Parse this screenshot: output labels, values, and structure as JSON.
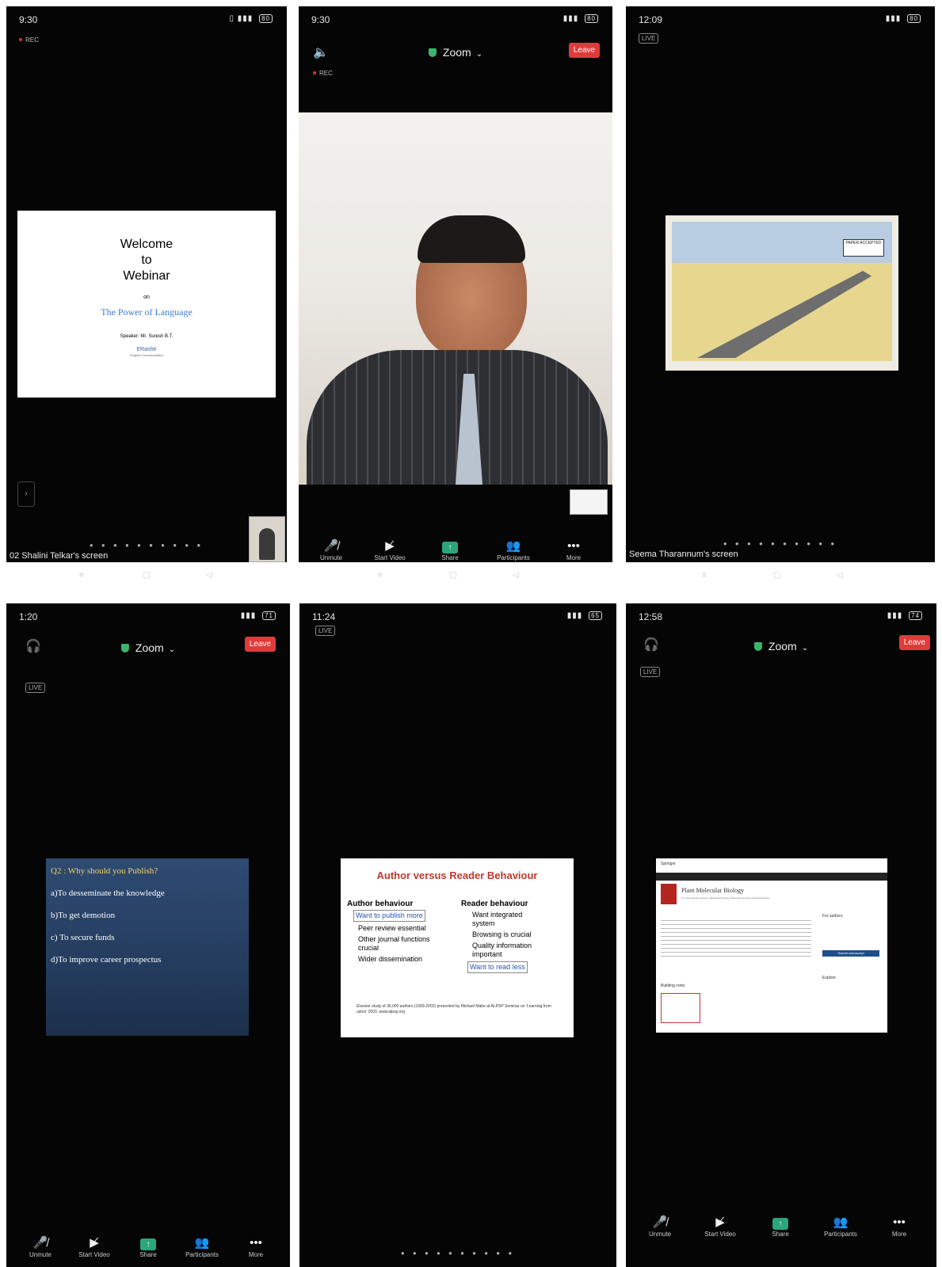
{
  "screens": {
    "s1": {
      "time": "9:30",
      "notif": "3",
      "battery": "80",
      "rec": "REC",
      "slide": {
        "line1": "Welcome",
        "line2": "to",
        "line3": "Webinar",
        "on": "on",
        "topic": "The Power of Language",
        "speaker": "Speaker: Mr. Suresh B.T.",
        "logo": "ERashtr",
        "logo_sub": "English Communication"
      },
      "screen_name": "02 Shalini Telkar's screen"
    },
    "s2": {
      "time": "9:30",
      "notif": "3",
      "battery": "80",
      "zoom_label": "Zoom",
      "leave_label": "Leave",
      "rec": "REC"
    },
    "s3": {
      "time": "12:09",
      "notif": "3",
      "battery": "80",
      "live": "LIVE",
      "sign_text": "PAPER ACCEPTED",
      "screen_name": "Seema Tharannum's screen"
    },
    "s4": {
      "time": "1:20",
      "notif": "3",
      "battery": "71",
      "zoom_label": "Zoom",
      "leave_label": "Leave",
      "live": "LIVE",
      "question": "Q2 : Why should you Publish?",
      "options": [
        "a)To desseminate the knowledge",
        "b)To get demotion",
        "c) To secure funds",
        "d)To improve career prospectus"
      ]
    },
    "s5": {
      "time": "11:24",
      "notif": "11",
      "battery": "65",
      "live": "LIVE",
      "title": "Author versus Reader Behaviour",
      "author_head": "Author behaviour",
      "author_items": [
        "Want to publish more",
        "Peer review essential",
        "Other journal functions crucial",
        "Wider dissemination"
      ],
      "reader_head": "Reader behaviour",
      "reader_items": [
        "Want integrated system",
        "Browsing is crucial",
        "Quality information important",
        "Want to read less"
      ],
      "footnote": "Elsevier study of 36,000 authors (1999-2002) presented by Michael Mabe at ALPSP Seminar on 'Learning from users' 2003, www.alpsp.org"
    },
    "s6": {
      "time": "12:58",
      "notif": "10",
      "battery": "74",
      "zoom_label": "Zoom",
      "leave_label": "Leave",
      "live": "LIVE",
      "site": "Springer",
      "journal": "Plant Molecular Biology",
      "journal_sub": "An International Journal on Molecular Biology, Molecular Genetics and Biochemistry",
      "for_authors": "For authors",
      "submit": "Submit manuscript",
      "explore": "Explore",
      "building": "Building roots"
    }
  },
  "toolbar": {
    "unmute": "Unmute",
    "start_video": "Start Video",
    "share": "Share",
    "participants": "Participants",
    "more": "More"
  },
  "colors": {
    "leave": "#e03b3b",
    "share": "#2aa67a",
    "zoom_shield": "#3bb56d",
    "slide_title_red": "#c0392b",
    "topic_blue": "#3a7bd5"
  }
}
